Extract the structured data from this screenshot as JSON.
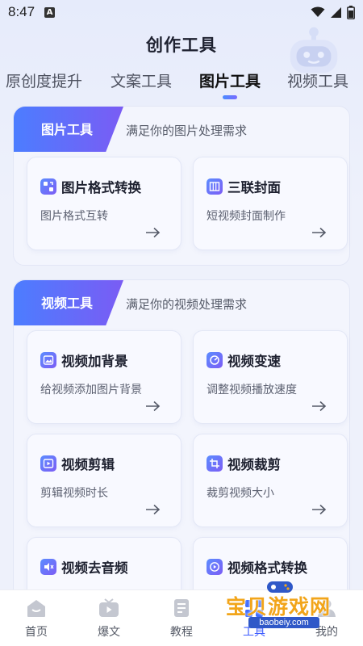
{
  "status_bar": {
    "time": "8:47",
    "notification_icon": "A"
  },
  "header": {
    "title": "创作工具"
  },
  "tabs": [
    {
      "label": "原创度提升"
    },
    {
      "label": "文案工具"
    },
    {
      "label": "图片工具",
      "active": true
    },
    {
      "label": "视频工具"
    }
  ],
  "sections": [
    {
      "badge": "图片工具",
      "description": "满足你的图片处理需求",
      "cards": [
        {
          "title": "图片格式转换",
          "subtitle": "图片格式互转",
          "icon": "image-convert-icon"
        },
        {
          "title": "三联封面",
          "subtitle": "短视频封面制作",
          "icon": "triptych-cover-icon"
        }
      ]
    },
    {
      "badge": "视频工具",
      "description": "满足你的视频处理需求",
      "cards": [
        {
          "title": "视频加背景",
          "subtitle": "给视频添加图片背景",
          "icon": "video-background-icon"
        },
        {
          "title": "视频变速",
          "subtitle": "调整视频播放速度",
          "icon": "video-speed-icon"
        },
        {
          "title": "视频剪辑",
          "subtitle": "剪辑视频时长",
          "icon": "video-edit-icon"
        },
        {
          "title": "视频裁剪",
          "subtitle": "裁剪视频大小",
          "icon": "video-crop-icon"
        },
        {
          "title": "视频去音频",
          "subtitle": "",
          "icon": "video-mute-icon"
        },
        {
          "title": "视频格式转换",
          "subtitle": "",
          "icon": "video-convert-icon"
        }
      ]
    }
  ],
  "bottom_nav": [
    {
      "label": "首页",
      "icon": "home-icon"
    },
    {
      "label": "爆文",
      "icon": "tv-icon"
    },
    {
      "label": "教程",
      "icon": "book-icon"
    },
    {
      "label": "工具",
      "icon": "tools-icon",
      "active": true
    },
    {
      "label": "我的",
      "icon": "profile-icon"
    }
  ],
  "watermark": {
    "text": "宝贝游戏网",
    "url": "baobeiy.com"
  },
  "colors": {
    "accent_start": "#4c7dff",
    "accent_end": "#7a5cf4",
    "background": "#eef1fb"
  }
}
